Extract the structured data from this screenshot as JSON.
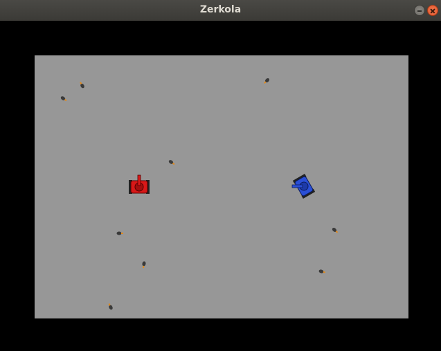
{
  "window": {
    "title": "Zerkola"
  },
  "colors": {
    "arena": "#979797",
    "background": "#000000",
    "red_tank": "#d81818",
    "blue_tank": "#2a4fd6",
    "bullet": "#3a3a3a",
    "bullet_flame": "#e08a1e"
  },
  "arena": {
    "red_tank": {
      "icon": "red-tank-icon",
      "turret": "up"
    },
    "blue_tank": {
      "icon": "blue-tank-icon",
      "turret": "left"
    },
    "bullet_count": 10
  }
}
